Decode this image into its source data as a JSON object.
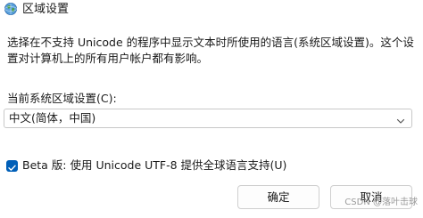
{
  "window": {
    "title": "区域设置",
    "title_icon": "globe-region-icon"
  },
  "description": "选择在不支持 Unicode 的程序中显示文本时所使用的语言(系统区域设置)。这个设置对计算机上的所有用户帐户都有影响。",
  "current_locale": {
    "label": "当前系统区域设置(C):",
    "value": "中文(简体，中国)",
    "dropdown_icon": "chevron-down-icon"
  },
  "beta_option": {
    "checked": true,
    "label": "Beta 版: 使用 Unicode UTF-8 提供全球语言支持(U)"
  },
  "buttons": {
    "ok": "确定",
    "cancel": "取消"
  },
  "watermark": "CSDN @落叶击球",
  "colors": {
    "accent": "#005fb8",
    "border": "#c8c8c8"
  }
}
